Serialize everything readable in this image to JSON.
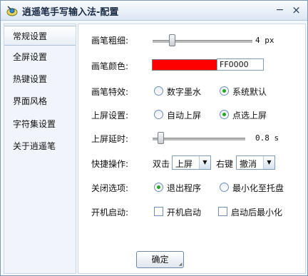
{
  "window": {
    "title": "逍遥笔手写输入法-配置",
    "minimize_glyph": "−",
    "close_glyph": "×"
  },
  "sidebar": {
    "items": [
      {
        "label": "常规设置",
        "active": true
      },
      {
        "label": "全屏设置",
        "active": false
      },
      {
        "label": "热键设置",
        "active": false
      },
      {
        "label": "界面风格",
        "active": false
      },
      {
        "label": "字符集设置",
        "active": false
      },
      {
        "label": "关于逍遥笔",
        "active": false
      }
    ]
  },
  "settings": {
    "stroke_width": {
      "label": "画笔粗细:",
      "value_text": "4 px",
      "level": 0.3
    },
    "stroke_color": {
      "label": "画笔颜色:",
      "hex": "FF0000",
      "color": "#ff0000"
    },
    "stroke_effect": {
      "label": "画笔特效:",
      "options": [
        "数字墨水",
        "系统默认"
      ],
      "selected": 1
    },
    "commit_mode": {
      "label": "上屏设置:",
      "options": [
        "自动上屏",
        "点选上屏"
      ],
      "selected": 1
    },
    "commit_delay": {
      "label": "上屏延时:",
      "value_text": "0.8 s",
      "level": 0.09
    },
    "shortcut": {
      "label": "快捷操作:",
      "double_click_label": "双击",
      "double_click_value": "上屏",
      "right_click_label": "右键",
      "right_click_value": "撤消"
    },
    "close_option": {
      "label": "关闭选项:",
      "options": [
        "退出程序",
        "最小化至托盘"
      ],
      "selected": 0
    },
    "startup": {
      "label": "开机启动:",
      "options": [
        "开机启动",
        "启动后最小化"
      ],
      "checked": [
        false,
        false
      ]
    }
  },
  "footer": {
    "ok_label": "确定"
  }
}
